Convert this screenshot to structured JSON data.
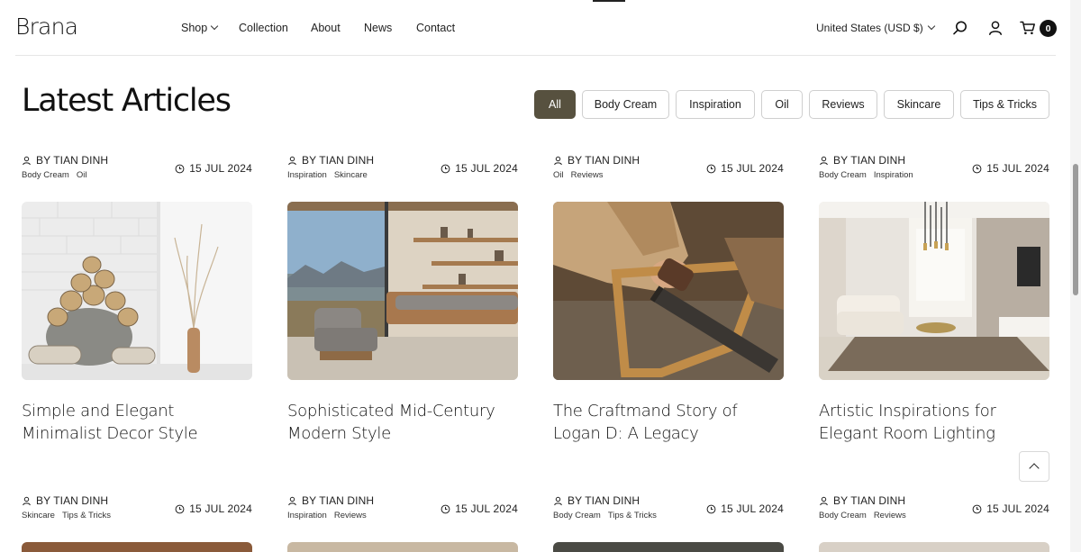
{
  "header": {
    "logo": "Brana",
    "nav": [
      {
        "label": "Shop"
      },
      {
        "label": "Collection"
      },
      {
        "label": "About"
      },
      {
        "label": "News"
      },
      {
        "label": "Contact"
      }
    ],
    "currency": "United States (USD $)",
    "cart_count": "0",
    "icons": [
      "search-icon",
      "user-icon",
      "cart-icon"
    ]
  },
  "page": {
    "title": "Latest Articles"
  },
  "filters": [
    "All",
    "Body Cream",
    "Inspiration",
    "Oil",
    "Reviews",
    "Skincare",
    "Tips & Tricks"
  ],
  "active_filter": "All",
  "accent_color": "#57513f",
  "articles": [
    {
      "author": "BY TIAN DINH",
      "tags": [
        "Body Cream",
        "Oil"
      ],
      "date": "15 JUL 2024",
      "title": "Simple and Elegant Minimalist Decor Style",
      "image": "firewood-basket-photo"
    },
    {
      "author": "BY TIAN DINH",
      "tags": [
        "Inspiration",
        "Skincare"
      ],
      "date": "15 JUL 2024",
      "title": "Sophisticated Mid-Century Modern Style",
      "image": "living-room-photo"
    },
    {
      "author": "BY TIAN DINH",
      "tags": [
        "Oil",
        "Reviews"
      ],
      "date": "15 JUL 2024",
      "title": "The Craftmand Story of Logan D: A Legacy",
      "image": "carpenter-saw-photo"
    },
    {
      "author": "BY TIAN DINH",
      "tags": [
        "Body Cream",
        "Inspiration"
      ],
      "date": "15 JUL 2024",
      "title": "Artistic Inspirations for Elegant Room Lighting",
      "image": "lounge-chandelier-photo"
    }
  ],
  "articles_row2": [
    {
      "author": "BY TIAN DINH",
      "tags": [
        "Skincare",
        "Tips & Tricks"
      ],
      "date": "15 JUL 2024"
    },
    {
      "author": "BY TIAN DINH",
      "tags": [
        "Inspiration",
        "Reviews"
      ],
      "date": "15 JUL 2024"
    },
    {
      "author": "BY TIAN DINH",
      "tags": [
        "Body Cream",
        "Tips & Tricks"
      ],
      "date": "15 JUL 2024"
    },
    {
      "author": "BY TIAN DINH",
      "tags": [
        "Body Cream",
        "Reviews"
      ],
      "date": "15 JUL 2024"
    }
  ]
}
